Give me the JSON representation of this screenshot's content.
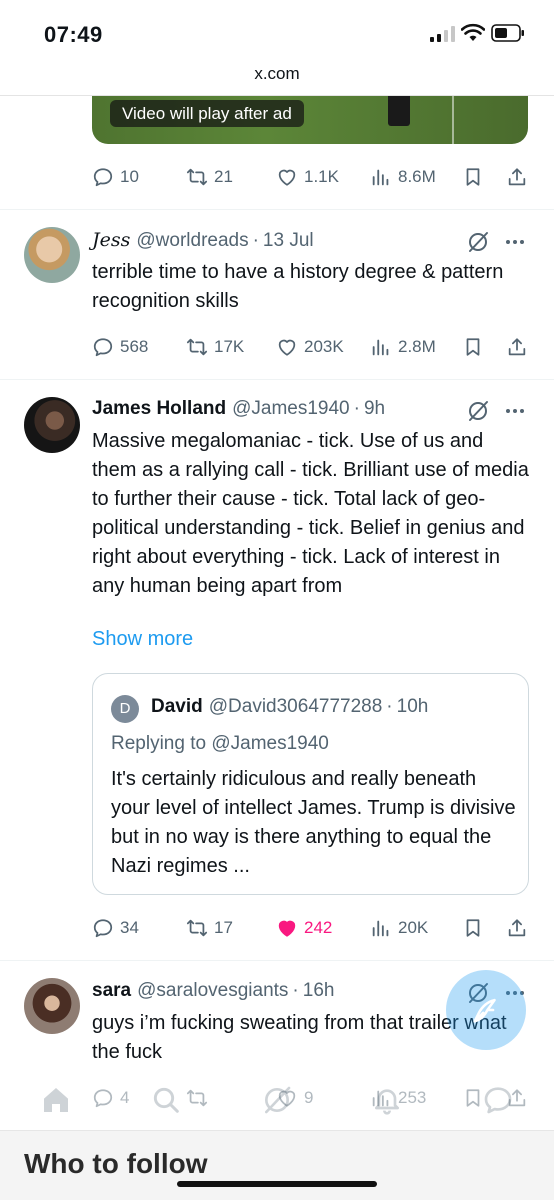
{
  "status_bar": {
    "time": "07:49"
  },
  "browser": {
    "url": "x.com"
  },
  "video_overlay": {
    "label": "Video will play after ad"
  },
  "tweets": [
    {
      "stats": {
        "replies": "10",
        "reposts": "21",
        "likes": "1.1K",
        "views": "8.6M"
      }
    },
    {
      "name": "Jess",
      "handle": "@worldreads",
      "time": "13 Jul",
      "text": "terrible time to have a history degree & pattern recognition skills",
      "stats": {
        "replies": "568",
        "reposts": "17K",
        "likes": "203K",
        "views": "2.8M"
      }
    },
    {
      "name": "James Holland",
      "handle": "@James1940",
      "time": "9h",
      "text": "Massive megalomaniac - tick. Use of us and them as a rallying call - tick. Brilliant use of media to further their cause - tick. Total lack of geo-political understanding - tick. Belief in genius and right about everything - tick. Lack of interest in any human being apart from",
      "show_more": "Show more",
      "quote": {
        "avatar_letter": "D",
        "name": "David",
        "handle": "@David3064777288",
        "time": "10h",
        "replying_to": "Replying to @James1940",
        "text": "It's certainly ridiculous and really beneath your level of intellect James. Trump is divisive but in no way is there anything to equal the Nazi regimes ..."
      },
      "stats": {
        "replies": "34",
        "reposts": "17",
        "likes": "242",
        "views": "20K",
        "liked": true
      }
    },
    {
      "name": "sara",
      "handle": "@saralovesgiants",
      "time": "16h",
      "text": "guys i’m fucking sweating from that trailer what the fuck",
      "stats": {
        "replies": "4",
        "reposts": "",
        "likes": "9",
        "views": "253"
      }
    }
  ],
  "sections": {
    "who_to_follow": "Who to follow"
  },
  "colors": {
    "accent": "#1d9bf0",
    "like": "#f91880",
    "muted": "#536471"
  }
}
